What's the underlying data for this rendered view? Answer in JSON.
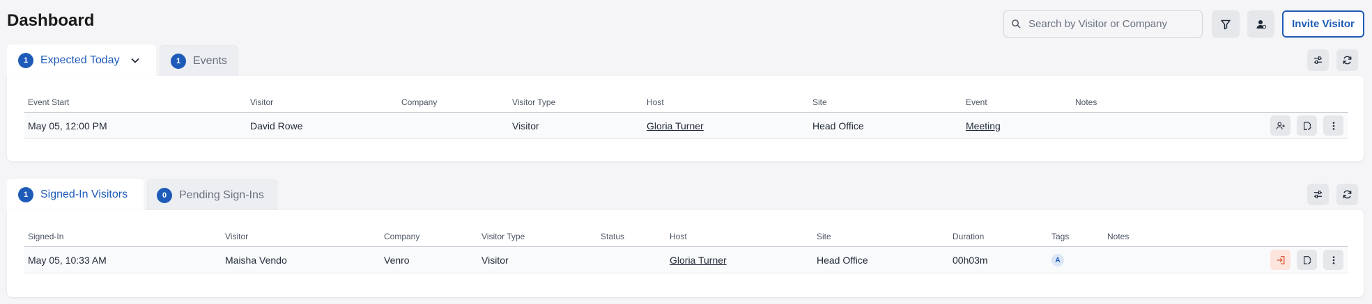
{
  "page": {
    "title": "Dashboard"
  },
  "header": {
    "search_placeholder": "Search by Visitor or Company",
    "invite_label": "Invite Visitor"
  },
  "expected": {
    "tabs": [
      {
        "count": "1",
        "label": "Expected Today"
      },
      {
        "count": "1",
        "label": "Events"
      }
    ],
    "columns": [
      "Event Start",
      "Visitor",
      "Company",
      "Visitor Type",
      "Host",
      "Site",
      "Event",
      "Notes"
    ],
    "rows": [
      {
        "event_start": "May 05, 12:00 PM",
        "visitor": "David Rowe",
        "company": "",
        "visitor_type": "Visitor",
        "host": "Gloria Turner",
        "site": "Head Office",
        "event": "Meeting",
        "notes": ""
      }
    ]
  },
  "signed_in": {
    "tabs": [
      {
        "count": "1",
        "label": "Signed-In Visitors"
      },
      {
        "count": "0",
        "label": "Pending Sign-Ins"
      }
    ],
    "columns": [
      "Signed-In",
      "Visitor",
      "Company",
      "Visitor Type",
      "Status",
      "Host",
      "Site",
      "Duration",
      "Tags",
      "Notes"
    ],
    "rows": [
      {
        "signed_in": "May 05, 10:33 AM",
        "visitor": "Maisha Vendo",
        "company": "Venro",
        "visitor_type": "Visitor",
        "status": "",
        "host": "Gloria Turner",
        "site": "Head Office",
        "duration": "00h03m",
        "tag": "A",
        "notes": ""
      }
    ]
  },
  "colors": {
    "accent": "#1e5bb8",
    "danger_bg": "#fde4dd",
    "danger": "#d9502f"
  }
}
